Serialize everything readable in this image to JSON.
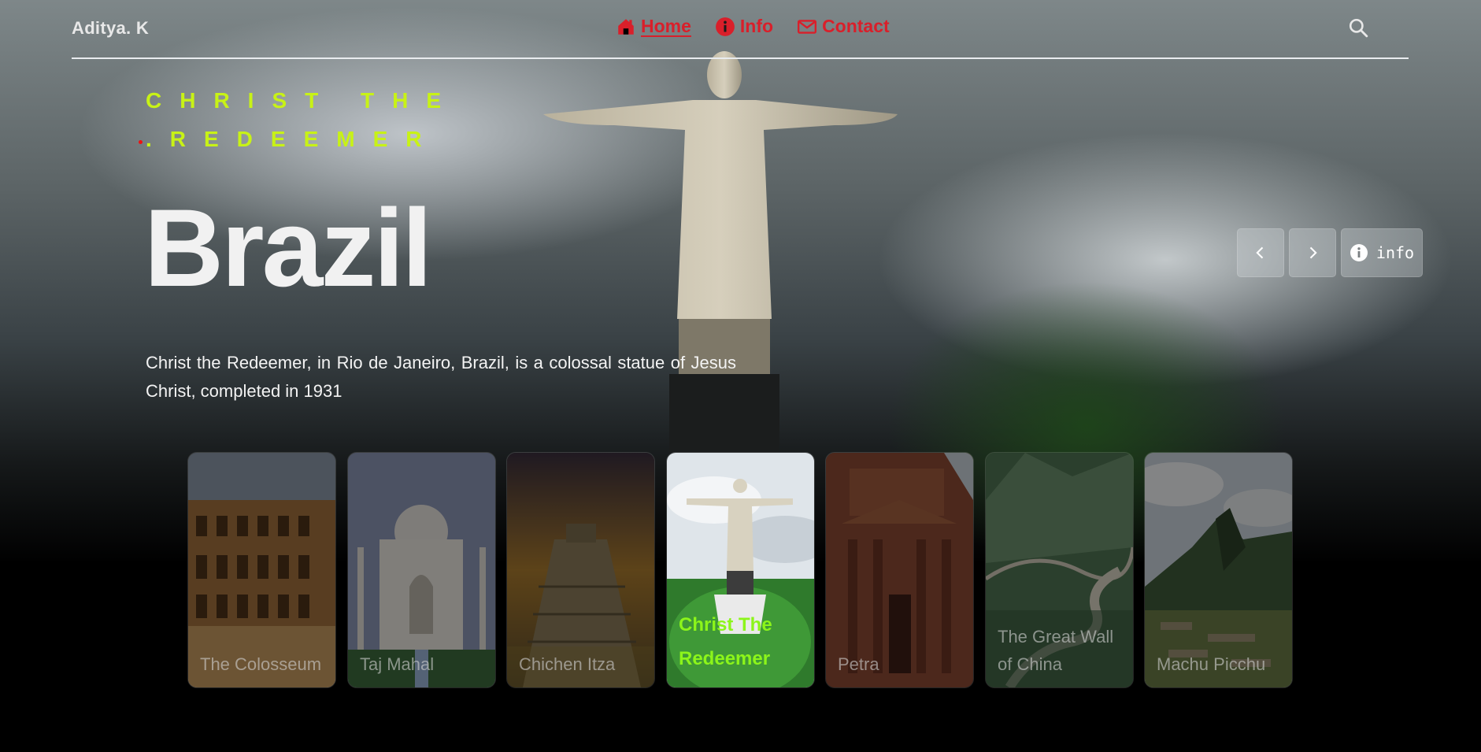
{
  "brand": "Aditya. K",
  "nav": {
    "items": [
      {
        "label": " Home",
        "icon": "home-icon",
        "active": true
      },
      {
        "label": "Info",
        "icon": "info-circle-icon",
        "active": false
      },
      {
        "label": "Contact",
        "icon": "envelope-icon",
        "active": false
      }
    ],
    "search_icon": "search-icon"
  },
  "hero": {
    "subtitle": "CHRIST THE .REDEEMER",
    "title": "Brazil",
    "description": "Christ the Redeemer, in Rio de Janeiro, Brazil, is a colossal statue of Jesus Christ, completed in 1931"
  },
  "controls": {
    "prev_icon": "chevron-left-icon",
    "next_icon": "chevron-right-icon",
    "info_label": "info",
    "info_icon": "info-circle-icon"
  },
  "cards": [
    {
      "caption": "The Colosseum",
      "active": false
    },
    {
      "caption": "Taj Mahal",
      "active": false
    },
    {
      "caption": "Chichen Itza",
      "active": false
    },
    {
      "caption": "Christ The Redeemer",
      "active": true
    },
    {
      "caption": "Petra",
      "active": false
    },
    {
      "caption": "The Great Wall of China",
      "active": false
    },
    {
      "caption": "Machu Picchu",
      "active": false
    }
  ],
  "colors": {
    "accent_red": "#d91f2a",
    "subtitle_lime": "#c8f216",
    "active_card_caption": "#8cf51a"
  }
}
